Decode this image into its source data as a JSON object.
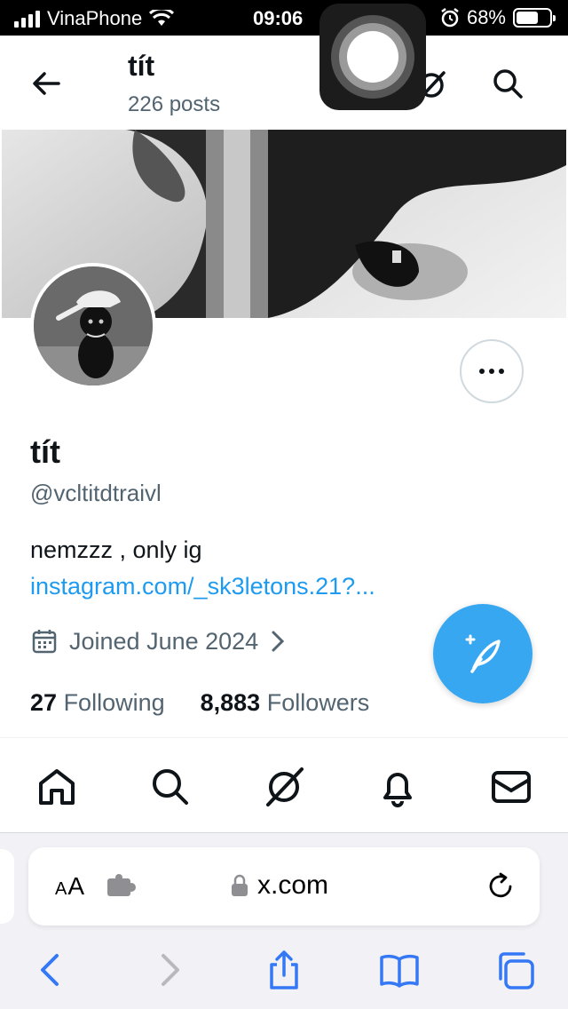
{
  "status_bar": {
    "carrier": "VinaPhone",
    "time": "09:06",
    "battery": "68%",
    "battery_level": 0.68
  },
  "header": {
    "title": "tít",
    "posts_count": "226 posts"
  },
  "profile": {
    "name": "tít",
    "handle": "@vcltitdtraivl",
    "bio": "nemzzz , only ig",
    "link": "instagram.com/_sk3letons.21?...",
    "joined": "Joined June 2024",
    "following_count": "27",
    "following_label": "Following",
    "followers_count": "8,883",
    "followers_label": "Followers"
  },
  "tabs": [
    "home-icon",
    "search-icon",
    "grok-icon",
    "notifications-icon",
    "messages-icon"
  ],
  "browser": {
    "aa_label_small": "A",
    "aa_label_large": "A",
    "url": "x.com"
  },
  "colors": {
    "accent": "#1d9bf0",
    "text_secondary": "#536471",
    "safari_blue": "#3478f6"
  }
}
